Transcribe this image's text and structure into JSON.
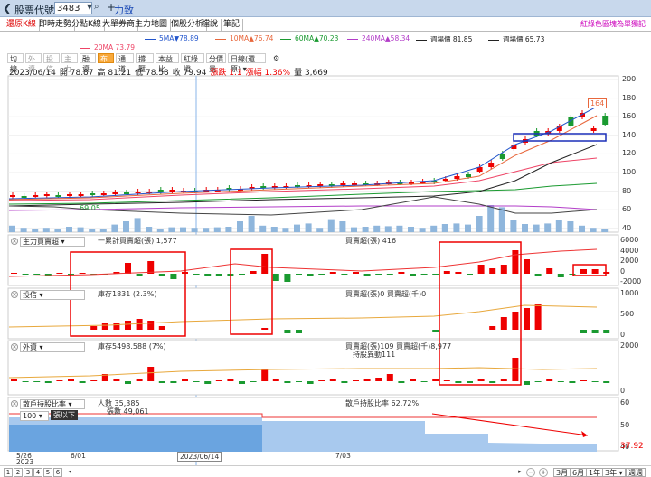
{
  "topbar": {
    "back_icon": "chevron-left-icon",
    "label": "股票代號",
    "code": "3483",
    "name": "力致"
  },
  "tabs": [
    "還原K線",
    "即時走勢",
    "分點K線",
    "大單券商",
    "主力地圖",
    "個股分析",
    "檔說",
    "筆記"
  ],
  "hint": "紅綠色區塊為單獨記",
  "ma": [
    {
      "label": "20MA",
      "value": "73.79",
      "color": "#ee4466"
    },
    {
      "label": "5MA",
      "value": "78.89",
      "arrow": "▼",
      "color": "#2255cc"
    },
    {
      "label": "10MA",
      "value": "76.74",
      "arrow": "▲",
      "color": "#e8673c"
    },
    {
      "label": "60MA",
      "value": "70.23",
      "arrow": "▲",
      "color": "#1a9a30"
    },
    {
      "label": "240MA",
      "value": "58.34",
      "arrow": "▲",
      "color": "#b23cc8"
    },
    {
      "label": "週場價",
      "value": "81.85",
      "color": "#222"
    },
    {
      "label": "週場價",
      "value": "65.73",
      "color": "#222"
    }
  ],
  "toolbar": {
    "items": [
      "均線",
      "外資",
      "投信",
      "主力",
      "融資",
      "布林",
      "通道",
      "撐壓",
      "本益比",
      "紅綠燈",
      "分價量",
      "日線(還原)"
    ],
    "disabled": [
      1,
      2,
      3
    ],
    "selected": 5,
    "gear": "gear-icon"
  },
  "ohlc": {
    "date": "2023/06/14",
    "open_label": "開",
    "open": "78.87",
    "high_label": "高",
    "high": "81.21",
    "low_label": "低",
    "low": "78.58",
    "close_label": "收",
    "close": "79.94",
    "chg_label": "漲跌",
    "chg": "1.1",
    "pct_label": "漲幅",
    "pct": "1.36%",
    "vol_label": "量",
    "vol": "3,669"
  },
  "price_annot": {
    "top": "164",
    "left": "69.05"
  },
  "price_axis": [
    "200",
    "180",
    "160",
    "140",
    "120",
    "100",
    "80",
    "60",
    "40"
  ],
  "panels": [
    {
      "select": "主力買賣超",
      "legend1": "一累計買賣超(張) 1,577",
      "legend2": "買賣超(張) 416",
      "axis": [
        "6000",
        "4000",
        "2000",
        "0",
        "-2000"
      ]
    },
    {
      "select": "投信",
      "legend1": "庫存1831 (2.3%)",
      "legend2": "買賣超(張)0 買賣超(千)0",
      "axis": [
        "1000",
        "500",
        "0"
      ]
    },
    {
      "select": "外資",
      "legend1": "庫存5498.588 (7%)",
      "legend2": "買賣超(張)109 買賣超(千)8,977",
      "legend3": "持股異動111",
      "axis": [
        "2000",
        "0"
      ]
    },
    {
      "select": "散戶持股比率",
      "legend1": "人數 35,385",
      "legend1b": "張數 49,061",
      "legend2": "散戶持股比率 62.72%",
      "filter_value": "100",
      "filter_label": "張以下",
      "axis": [
        "60",
        "50",
        "40"
      ],
      "badge": "37.92"
    }
  ],
  "x_axis": [
    "5/26",
    "2023",
    "6/01",
    "2023/06/14",
    "7/03"
  ],
  "pages": [
    "1",
    "2",
    "3",
    "4",
    "5",
    "6"
  ],
  "ranges": [
    "3月",
    "6月",
    "1年",
    "3年",
    "週週"
  ],
  "chart_data": {
    "type": "candlestick",
    "dates": [
      "5/26",
      "6/01",
      "6/14",
      "7/03"
    ],
    "selected": {
      "date": "2023/06/14",
      "open": 78.87,
      "high": 81.21,
      "low": 78.58,
      "close": 79.94,
      "volume": 3669
    },
    "ylim": [
      40,
      200
    ],
    "last": {
      "high": 164
    }
  }
}
